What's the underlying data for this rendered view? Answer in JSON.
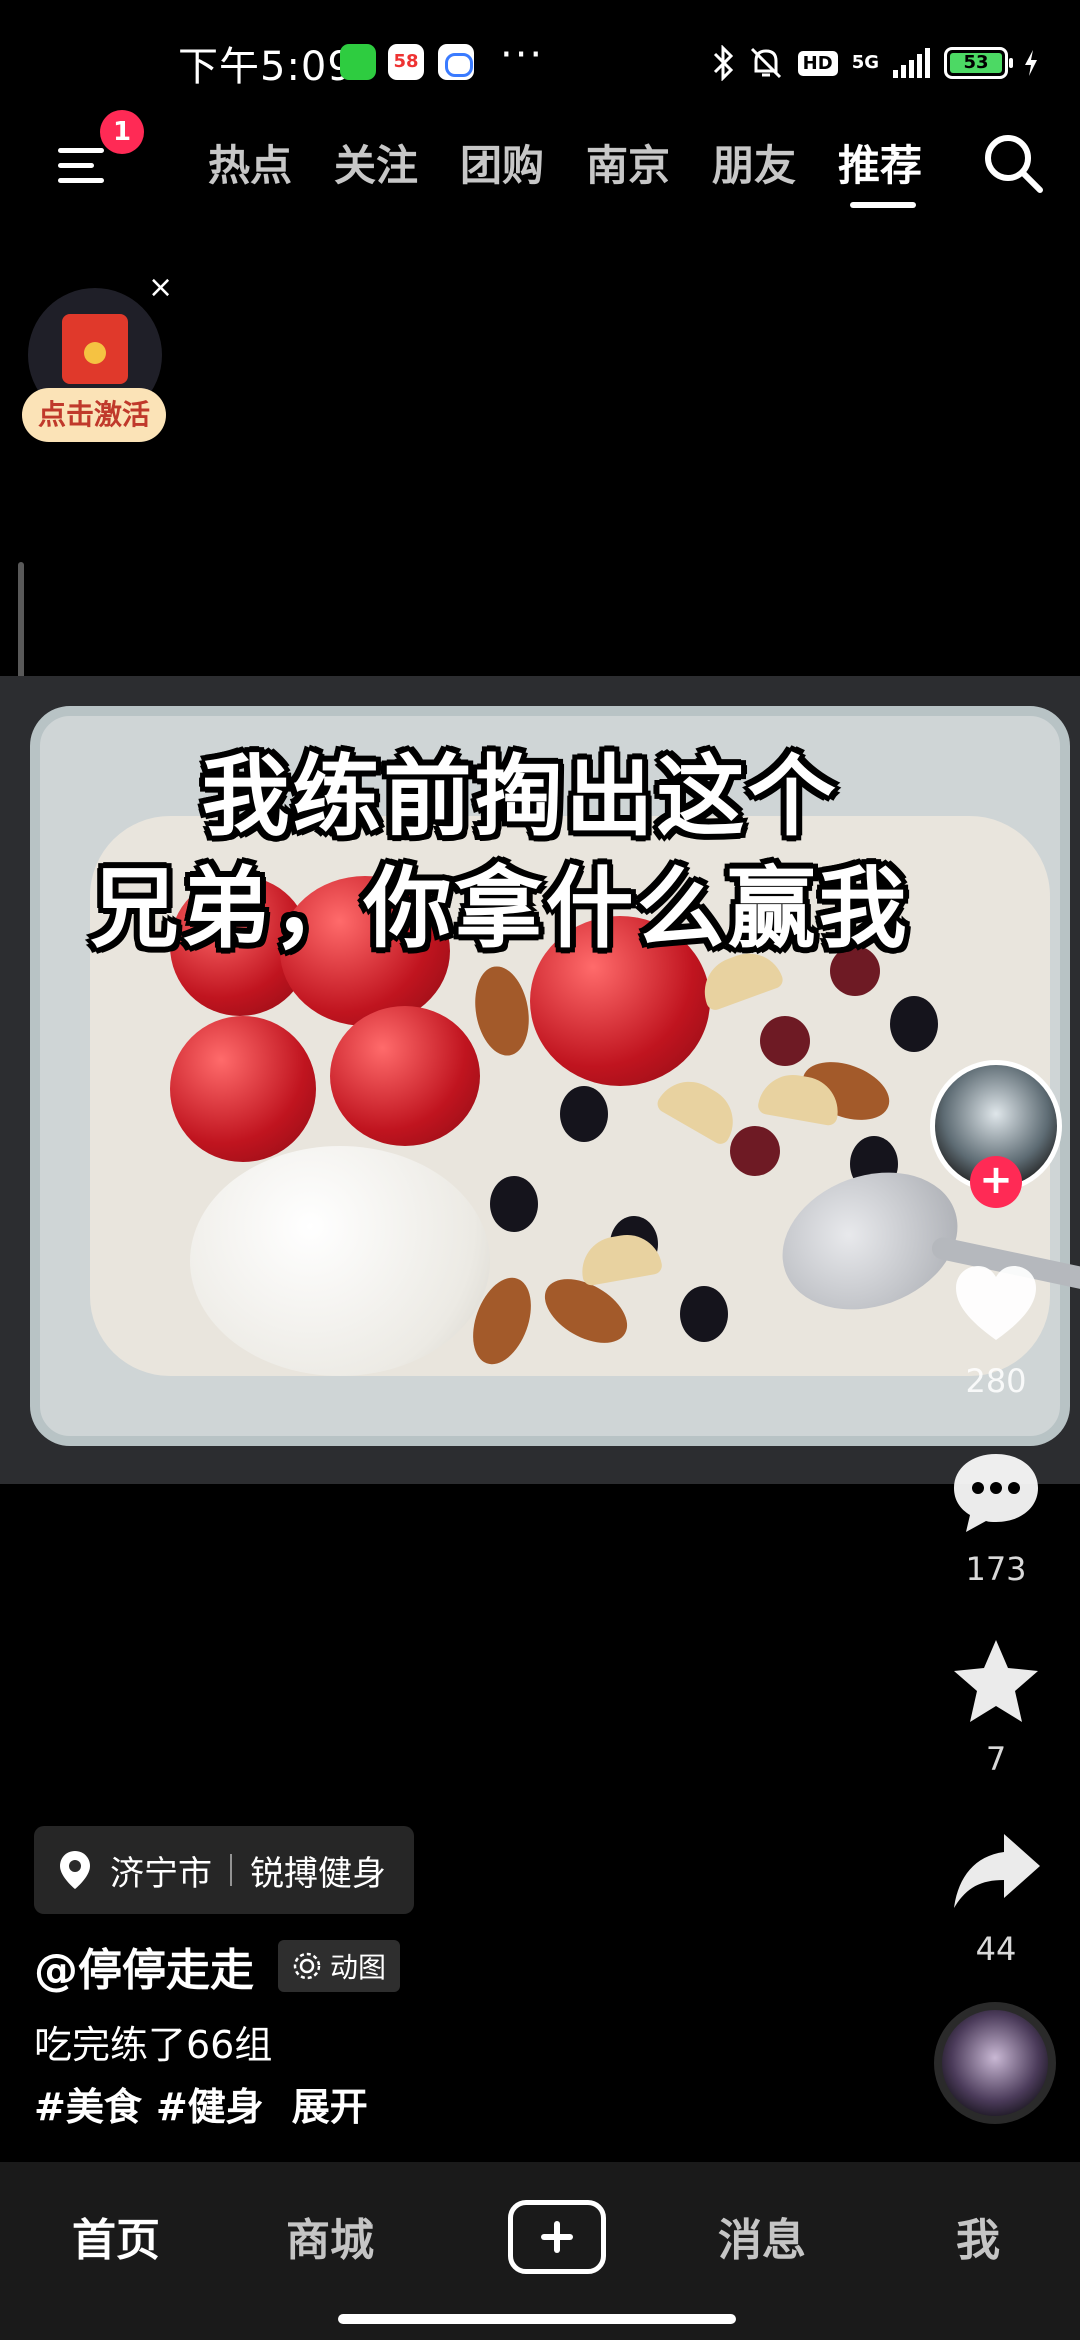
{
  "status_bar": {
    "time": "下午5:09",
    "app_58_label": "58",
    "more": "···",
    "network": "5G",
    "hd": "HD",
    "battery": "53"
  },
  "top_nav": {
    "notification_count": "1",
    "tabs": [
      "热点",
      "关注",
      "团购",
      "南京",
      "朋友",
      "推荐"
    ],
    "active_tab": "推荐"
  },
  "red_packet": {
    "close": "×",
    "button_label": "点击激活"
  },
  "video": {
    "caption_line1": "我练前掏出这个",
    "caption_line2": "兄弟，你拿什么赢我"
  },
  "actions": {
    "likes": "280",
    "comments": "173",
    "favorites": "7",
    "shares": "44"
  },
  "post": {
    "location_city": "济宁市",
    "location_place": "锐搏健身",
    "username": "@停停走走",
    "gif_label": "动图",
    "description": "吃完练了66组",
    "tags": [
      "#美食",
      "#健身"
    ],
    "expand": "展开"
  },
  "bottom_nav": {
    "items": [
      "首页",
      "商城",
      "消息",
      "我"
    ]
  },
  "colors": {
    "accent": "#ff2a55",
    "battery_green": "#4cd964",
    "background": "#000000"
  }
}
